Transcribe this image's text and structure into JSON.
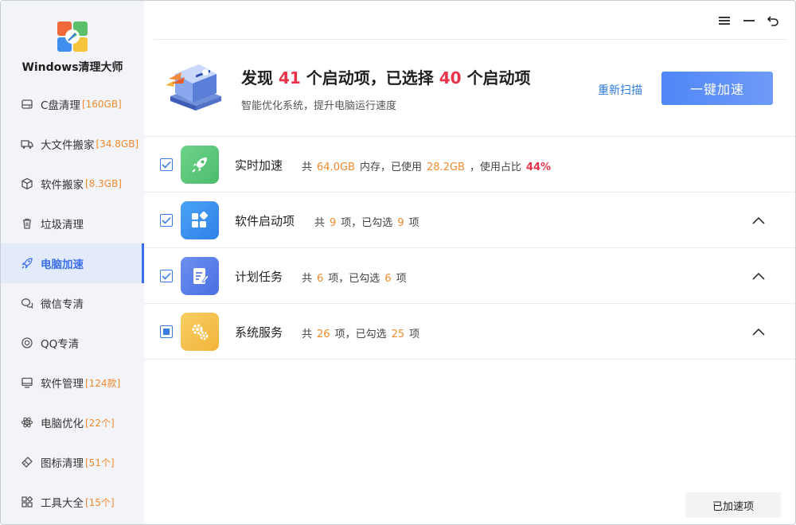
{
  "app": {
    "title": "Windows清理大师"
  },
  "colors": {
    "accent": "#3a6fe8",
    "orange": "#f08a2c",
    "red": "#e8334a"
  },
  "window_controls": {
    "menu": "menu-icon",
    "minimize": "minimize-icon",
    "back": "back-icon"
  },
  "sidebar": {
    "items": [
      {
        "label": "C盘清理",
        "sub": "[160GB]",
        "icon": "disk-icon"
      },
      {
        "label": "大文件搬家",
        "sub": "[34.8GB]",
        "icon": "truck-icon"
      },
      {
        "label": "软件搬家",
        "sub": "[8.3GB]",
        "icon": "box-icon"
      },
      {
        "label": "垃圾清理",
        "sub": "",
        "icon": "trash-icon"
      },
      {
        "label": "电脑加速",
        "sub": "",
        "icon": "rocket-icon",
        "active": true
      },
      {
        "label": "微信专清",
        "sub": "",
        "icon": "wechat-icon"
      },
      {
        "label": "QQ专清",
        "sub": "",
        "icon": "qq-icon"
      },
      {
        "label": "软件管理",
        "sub": "[124款]",
        "icon": "monitor-icon"
      },
      {
        "label": "电脑优化",
        "sub": "[22个]",
        "icon": "atom-icon"
      },
      {
        "label": "图标清理",
        "sub": "[51个]",
        "icon": "brush-icon"
      },
      {
        "label": "工具大全",
        "sub": "[15个]",
        "icon": "grid-icon"
      }
    ]
  },
  "header": {
    "prefix": "发现",
    "found": "41",
    "mid": "个启动项，已选择",
    "selected": "40",
    "suffix": "个启动项",
    "subtitle": "智能优化系统，提升电脑运行速度",
    "rescan": "重新扫描",
    "boost": "一键加速"
  },
  "rows": [
    {
      "title": "实时加速",
      "icon": "rocket-icon",
      "desc": {
        "a": "共",
        "mem": "64.0GB",
        "b": "内存，已使用",
        "used": "28.2GB",
        "c": "，使用占比",
        "pct": "44%"
      }
    },
    {
      "title": "软件启动项",
      "icon": "apps-icon",
      "desc": {
        "a": "共",
        "total": "9",
        "b": "项，已勾选",
        "checked": "9",
        "c": "项"
      }
    },
    {
      "title": "计划任务",
      "icon": "task-icon",
      "desc": {
        "a": "共",
        "total": "6",
        "b": "项，已勾选",
        "checked": "6",
        "c": "项"
      }
    },
    {
      "title": "系统服务",
      "icon": "gears-icon",
      "desc": {
        "a": "共",
        "total": "26",
        "b": "项，已勾选",
        "checked": "25",
        "c": "项"
      }
    }
  ],
  "footer": {
    "done": "已加速项"
  }
}
